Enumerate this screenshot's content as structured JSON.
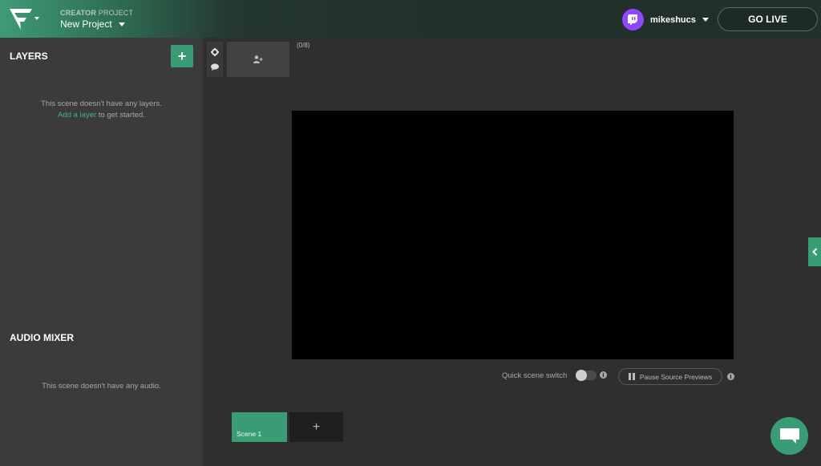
{
  "header": {
    "project_kind_bold": "CREATOR",
    "project_kind_rest": " PROJECT",
    "project_name": "New Project",
    "username": "mikeshucs",
    "go_live_label": "GO LIVE"
  },
  "layers": {
    "title": "LAYERS",
    "add_label": "+",
    "empty_line1": "This scene doesn't have any layers.",
    "empty_link": "Add a layer",
    "empty_line2_rest": " to get started."
  },
  "audio_mixer": {
    "title": "AUDIO MIXER",
    "empty_text": "This scene doesn't have any audio."
  },
  "guests": {
    "count": "(0/8)"
  },
  "controls": {
    "quick_switch_label": "Quick scene switch",
    "info_glyph": "i",
    "pause_label": "Pause Source Previews"
  },
  "scenes": {
    "items": [
      {
        "label": "Scene 1"
      }
    ],
    "add_label": "+"
  },
  "colors": {
    "accent": "#3a9c75",
    "twitch": "#9147ff"
  },
  "icons": {
    "logo": "brand-logo-icon",
    "settings": "gear-icon",
    "chat": "chat-bubble-icon",
    "add_guest": "add-user-icon",
    "collapse": "chevron-left-icon"
  }
}
